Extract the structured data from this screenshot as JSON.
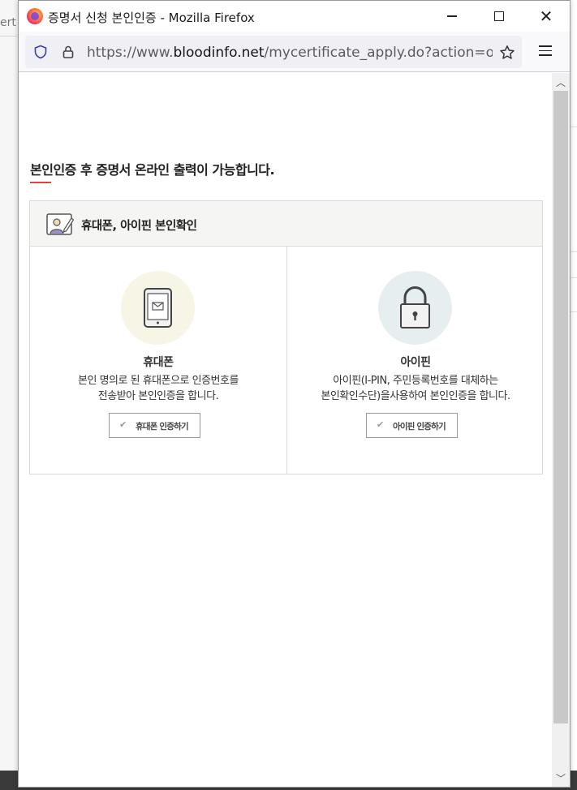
{
  "background": {
    "left_text": "ert"
  },
  "window": {
    "title": "증명서 신청 본인인증 - Mozilla Firefox",
    "url_prefix": "https://www.",
    "url_host": "bloodinfo.net",
    "url_path": "/mycertificate_apply.do?action=online"
  },
  "page": {
    "heading": "본인인증 후 증명서 온라인 출력이 가능합니다.",
    "panel_title": "휴대폰, 아이핀 본인확인",
    "options": [
      {
        "title": "휴대폰",
        "desc_line1": "본인 명의로 된 휴대폰으로 인증번호를",
        "desc_line2": "전송받아 본인인증을 합니다.",
        "button": "휴대폰 인증하기",
        "icon": "phone-icon"
      },
      {
        "title": "아이핀",
        "desc_line1": "아이핀(I-PIN, 주민등록번호를 대체하는",
        "desc_line2": "본인확인수단)을사용하여 본인인증을 합니다.",
        "button": "아이핀 인증하기",
        "icon": "lock-icon"
      }
    ]
  },
  "colors": {
    "accent_red": "#e2423f",
    "phone_circle": "#f7f6e6",
    "lock_circle": "#e7eef0"
  }
}
